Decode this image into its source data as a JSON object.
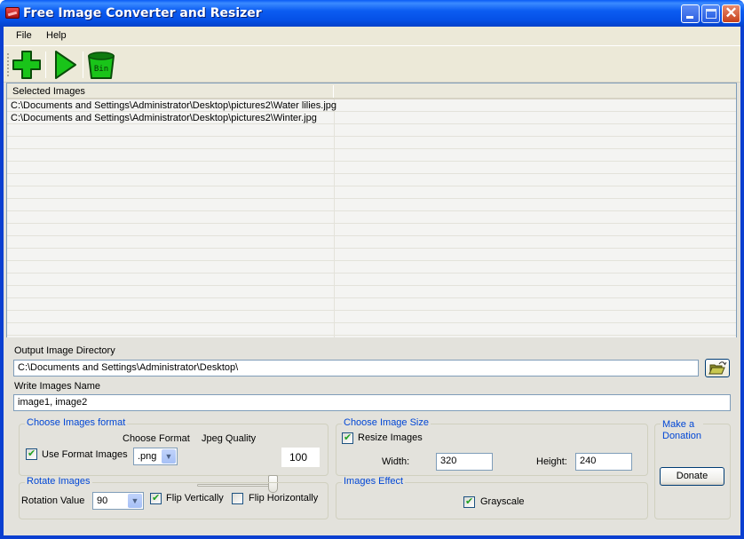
{
  "window": {
    "title": "Free Image Converter and Resizer",
    "controls": {
      "minimize": "minimize",
      "maximize": "maximize",
      "close": "✕"
    }
  },
  "menu": {
    "items": [
      {
        "label": "File"
      },
      {
        "label": "Help"
      }
    ]
  },
  "toolbar": {
    "buttons": [
      {
        "icon": "add-icon",
        "tooltip": "Add"
      },
      {
        "icon": "play-icon",
        "tooltip": "Start"
      },
      {
        "icon": "bin-icon",
        "label": "Bin"
      }
    ]
  },
  "list": {
    "header": "Selected Images",
    "rows": [
      "C:\\Documents and Settings\\Administrator\\Desktop\\pictures2\\Water lilies.jpg",
      "C:\\Documents and Settings\\Administrator\\Desktop\\pictures2\\Winter.jpg"
    ]
  },
  "output": {
    "directory_label": "Output Image Directory",
    "directory_value": "C:\\Documents and Settings\\Administrator\\Desktop\\",
    "name_label": "Write Images Name",
    "name_value": "image1, image2"
  },
  "format_group": {
    "title": "Choose Images format",
    "use_format_label": "Use Format Images",
    "use_format_checked": true,
    "choose_format_label": "Choose Format",
    "format_value": ".png",
    "jpeg_quality_label": "Jpeg Quality",
    "jpeg_quality_value": "100",
    "jpeg_quality_percent": 100
  },
  "rotate_group": {
    "title": "Rotate Images",
    "rotation_label": "Rotation Value",
    "rotation_value": "90",
    "flip_vertical_label": "Flip Vertically",
    "flip_vertical_checked": true,
    "flip_horizontal_label": "Flip Horizontally",
    "flip_horizontal_checked": false
  },
  "size_group": {
    "title": "Choose Image Size",
    "resize_label": "Resize Images",
    "resize_checked": true,
    "width_label": "Width:",
    "width_value": "320",
    "height_label": "Height:",
    "height_value": "240"
  },
  "effect_group": {
    "title": "Images Effect",
    "grayscale_label": "Grayscale",
    "grayscale_checked": true
  },
  "donation_group": {
    "title_line1": "Make a",
    "title_line2": "Donation",
    "donate_label": "Donate"
  },
  "colors": {
    "titlebar": "#0a5bf6",
    "group_title": "#0046d5",
    "toolbar_green": "#19c419"
  }
}
